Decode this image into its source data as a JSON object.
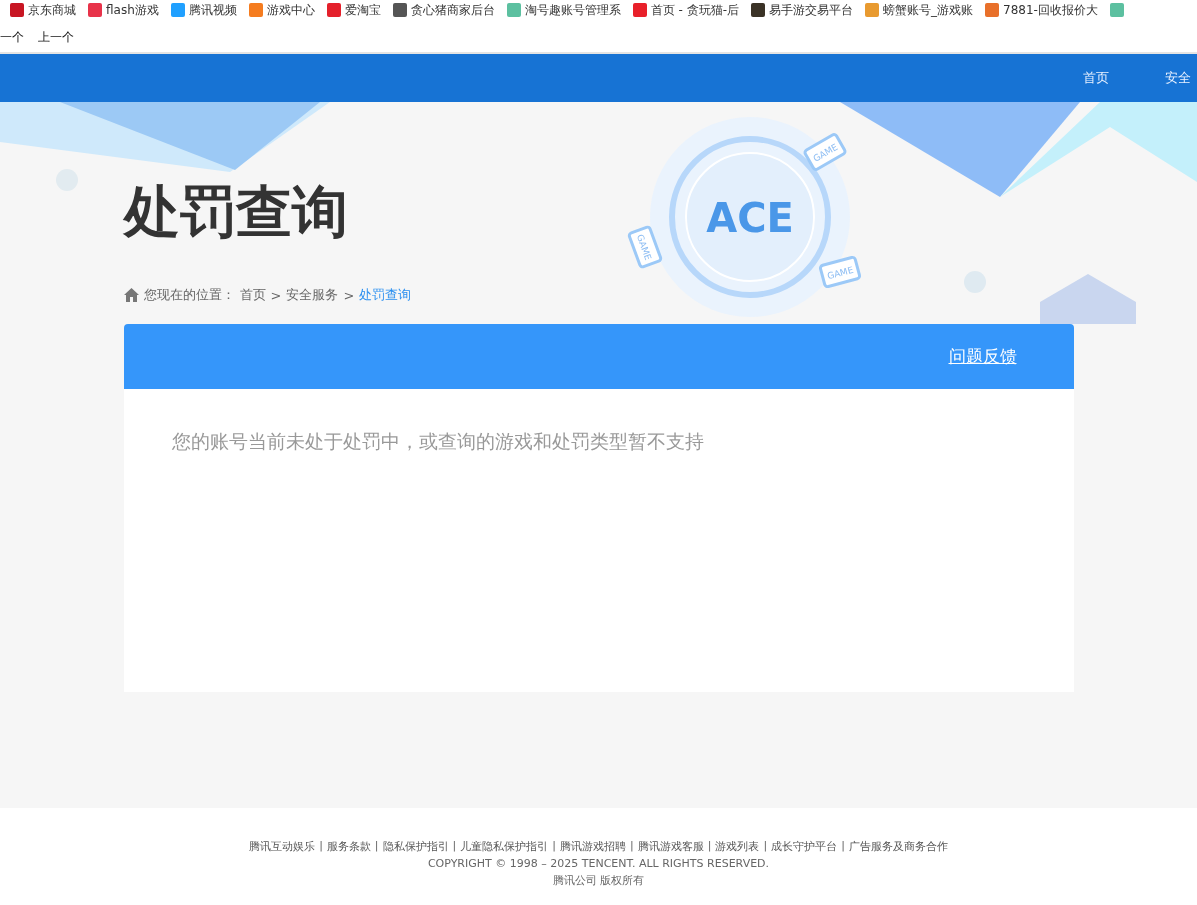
{
  "bookmarks": [
    {
      "label": "京东商城",
      "color": "#c81623"
    },
    {
      "label": "flash游戏",
      "color": "#e8334a"
    },
    {
      "label": "腾讯视频",
      "color": "#20a0ff"
    },
    {
      "label": "游戏中心",
      "color": "#f57c1f"
    },
    {
      "label": "爱淘宝",
      "color": "#e4202b"
    },
    {
      "label": "贪心猪商家后台",
      "color": "#555555"
    },
    {
      "label": "淘号趣账号管理系",
      "color": "#5cc0a0"
    },
    {
      "label": "首页 - 贪玩猫-后",
      "color": "#e8202a"
    },
    {
      "label": "易手游交易平台",
      "color": "#3a3226"
    },
    {
      "label": "螃蟹账号_游戏账",
      "color": "#e89a30"
    },
    {
      "label": "7881-回收报价大",
      "color": "#e8702a"
    },
    {
      "color": "#5cc0a0"
    }
  ],
  "find_bar": {
    "next": "一个",
    "previous": "上一个"
  },
  "nav": [
    {
      "label": "首页"
    },
    {
      "label": "安全"
    }
  ],
  "banner": {
    "title": "处罚查询",
    "logo": "ACE",
    "devices": [
      "GAME",
      "GAME",
      "GAME"
    ]
  },
  "breadcrumb": {
    "prefix": "您现在的位置：",
    "items": [
      {
        "label": "首页",
        "selected": false
      },
      {
        "label": "安全服务",
        "selected": false
      },
      {
        "label": "处罚查询",
        "selected": true
      }
    ],
    "separator": ">"
  },
  "panel": {
    "feedback": "问题反馈",
    "message": "您的账号当前未处于处罚中，或查询的游戏和处罚类型暂不支持"
  },
  "footer": {
    "links": [
      "腾讯互动娱乐",
      "服务条款",
      "隐私保护指引",
      "儿童隐私保护指引",
      "腾讯游戏招聘",
      "腾讯游戏客服",
      "游戏列表",
      "成长守护平台",
      "广告服务及商务合作"
    ],
    "copyright": "COPYRIGHT © 1998 – 2025 TENCENT. ALL RIGHTS RESERVED.",
    "company": "腾讯公司 版权所有",
    "separator": "|"
  }
}
